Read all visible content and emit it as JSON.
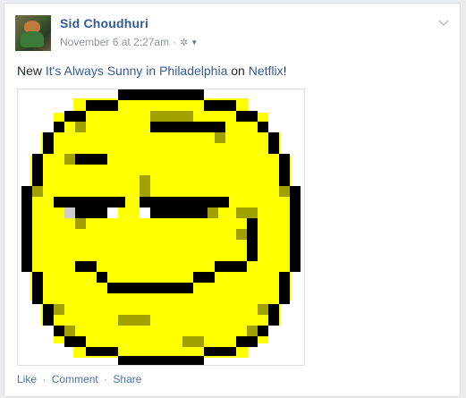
{
  "post": {
    "author": "Sid Choudhuri",
    "timestamp": "November 6 at 2:27am",
    "separator": "·",
    "text_prefix": "New ",
    "link_show": "It's Always Sunny in Philadelphia",
    "text_middle": " on ",
    "link_platform": "Netflix",
    "text_suffix": "!"
  },
  "actions": {
    "like": "Like",
    "comment": "Comment",
    "share": "Share",
    "dot": "·"
  },
  "icons": {
    "privacy": "gear-icon",
    "audience_caret": "caret-down-icon",
    "options": "chevron-down-icon"
  },
  "colors": {
    "link": "#365899",
    "face_yellow": "#ffff00",
    "face_shade": "#a0a000",
    "outline": "#000000"
  }
}
